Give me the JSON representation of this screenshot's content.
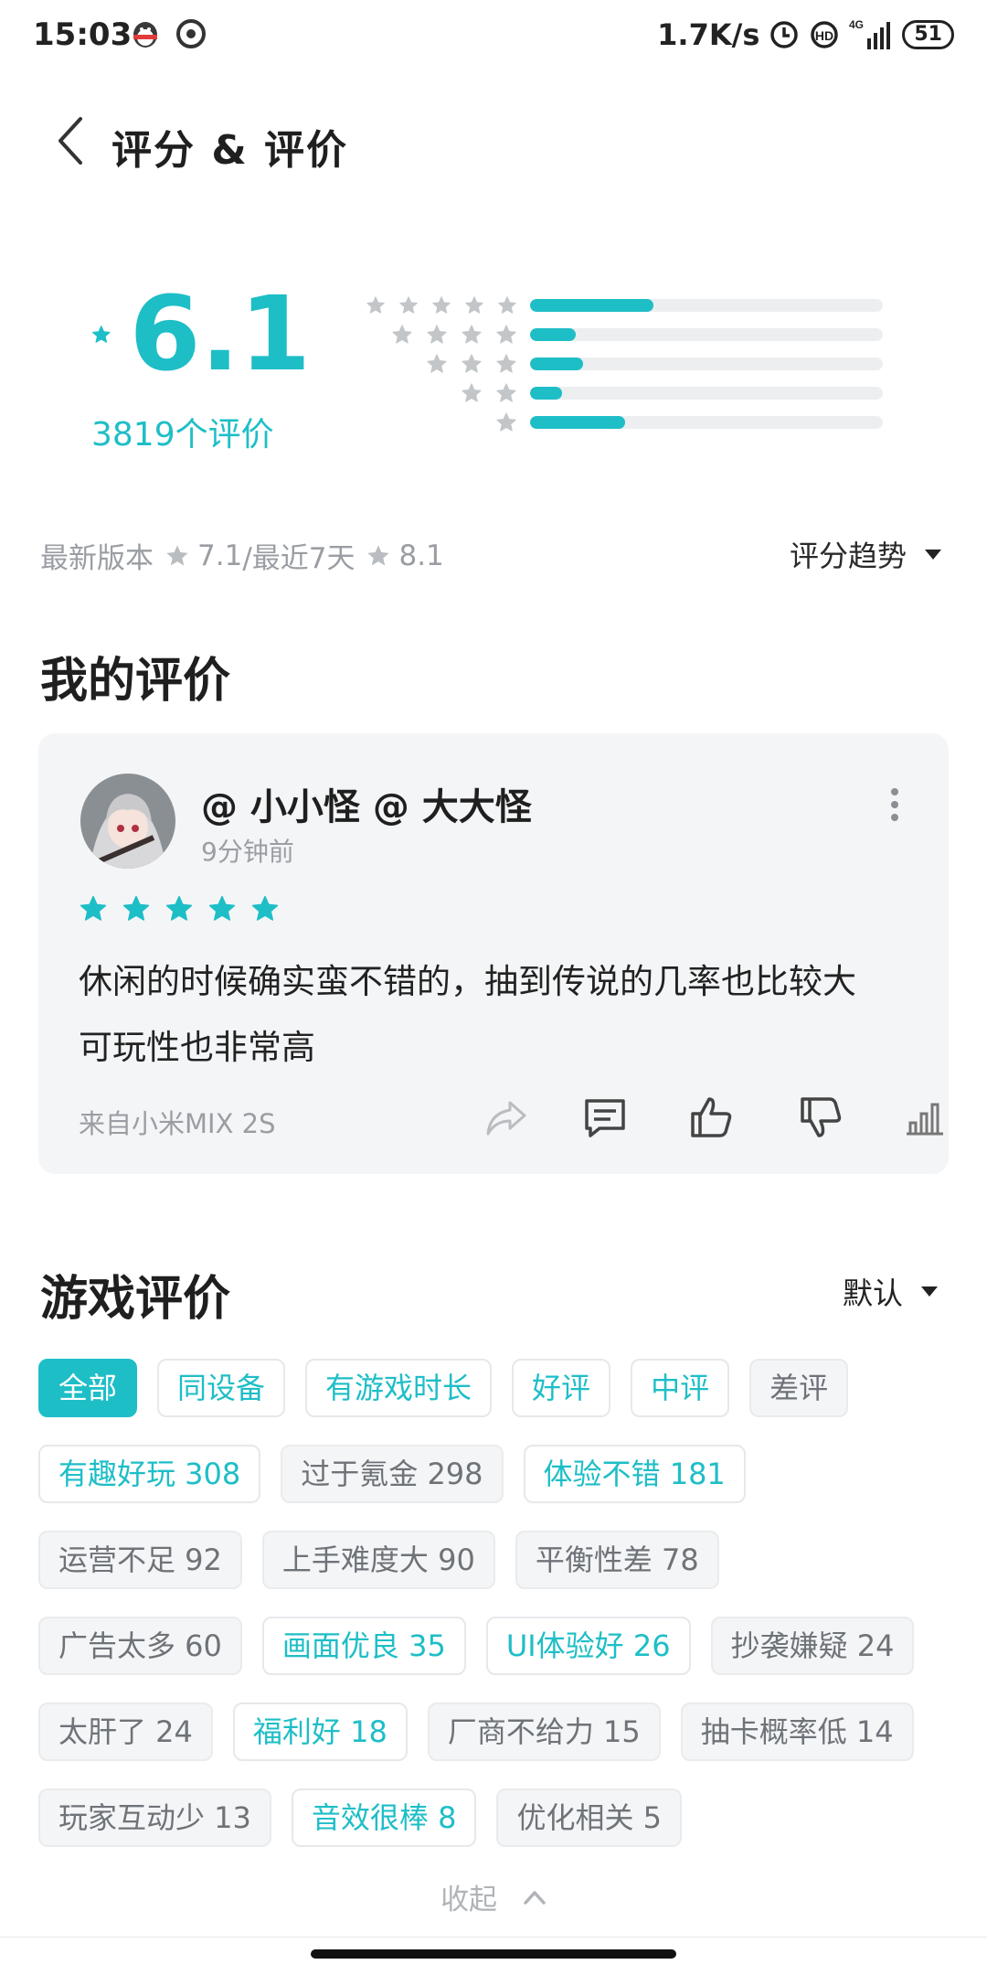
{
  "status_bar": {
    "time": "15:03",
    "speed": "1.7K/s",
    "network": "4G",
    "battery": "51"
  },
  "header": {
    "title": "评分 & 评价"
  },
  "rating": {
    "score": "6.1",
    "count_label": "3819个评价",
    "distribution": [
      {
        "stars": 5,
        "fraction": 0.35
      },
      {
        "stars": 4,
        "fraction": 0.13
      },
      {
        "stars": 3,
        "fraction": 0.15
      },
      {
        "stars": 2,
        "fraction": 0.09
      },
      {
        "stars": 1,
        "fraction": 0.27
      }
    ]
  },
  "version": {
    "prefix": "最新版本",
    "latest": "7.1",
    "recent_label": "/最近7天",
    "recent": "8.1",
    "trend_label": "评分趋势"
  },
  "my_review": {
    "section_title": "我的评价",
    "username": "@ 小小怪 @ 大大怪",
    "time": "9分钟前",
    "stars": 5,
    "text_line1": "休闲的时候确实蛮不错的，抽到传说的几率也比较大",
    "text_line2": "可玩性也非常高",
    "device": "来自小米MIX 2S"
  },
  "game_reviews": {
    "section_title": "游戏评价",
    "sort_label": "默认",
    "filters": [
      {
        "label": "全部",
        "style": "active"
      },
      {
        "label": "同设备",
        "style": "teal"
      },
      {
        "label": "有游戏时长",
        "style": "teal"
      },
      {
        "label": "好评",
        "style": "teal"
      },
      {
        "label": "中评",
        "style": "teal"
      },
      {
        "label": "差评",
        "style": "gray"
      }
    ],
    "tags": [
      [
        {
          "label": "有趣好玩 308",
          "style": "teal"
        },
        {
          "label": "过于氪金 298",
          "style": "gray"
        },
        {
          "label": "体验不错 181",
          "style": "teal"
        }
      ],
      [
        {
          "label": "运营不足 92",
          "style": "gray"
        },
        {
          "label": "上手难度大 90",
          "style": "gray"
        },
        {
          "label": "平衡性差 78",
          "style": "gray"
        }
      ],
      [
        {
          "label": "广告太多 60",
          "style": "gray"
        },
        {
          "label": "画面优良 35",
          "style": "teal"
        },
        {
          "label": "UI体验好  26",
          "style": "teal"
        },
        {
          "label": "抄袭嫌疑 24",
          "style": "gray"
        }
      ],
      [
        {
          "label": "太肝了 24",
          "style": "gray"
        },
        {
          "label": "福利好 18",
          "style": "teal"
        },
        {
          "label": "厂商不给力 15",
          "style": "gray"
        },
        {
          "label": "抽卡概率低 14",
          "style": "gray"
        }
      ],
      [
        {
          "label": "玩家互动少 13",
          "style": "gray"
        },
        {
          "label": "音效很棒 8",
          "style": "teal"
        },
        {
          "label": "优化相关 5",
          "style": "gray"
        }
      ]
    ],
    "collapse_label": "收起"
  },
  "colors": {
    "accent": "#1ebec7",
    "muted_text": "#9a9ea3",
    "card_bg": "#f4f5f7"
  }
}
